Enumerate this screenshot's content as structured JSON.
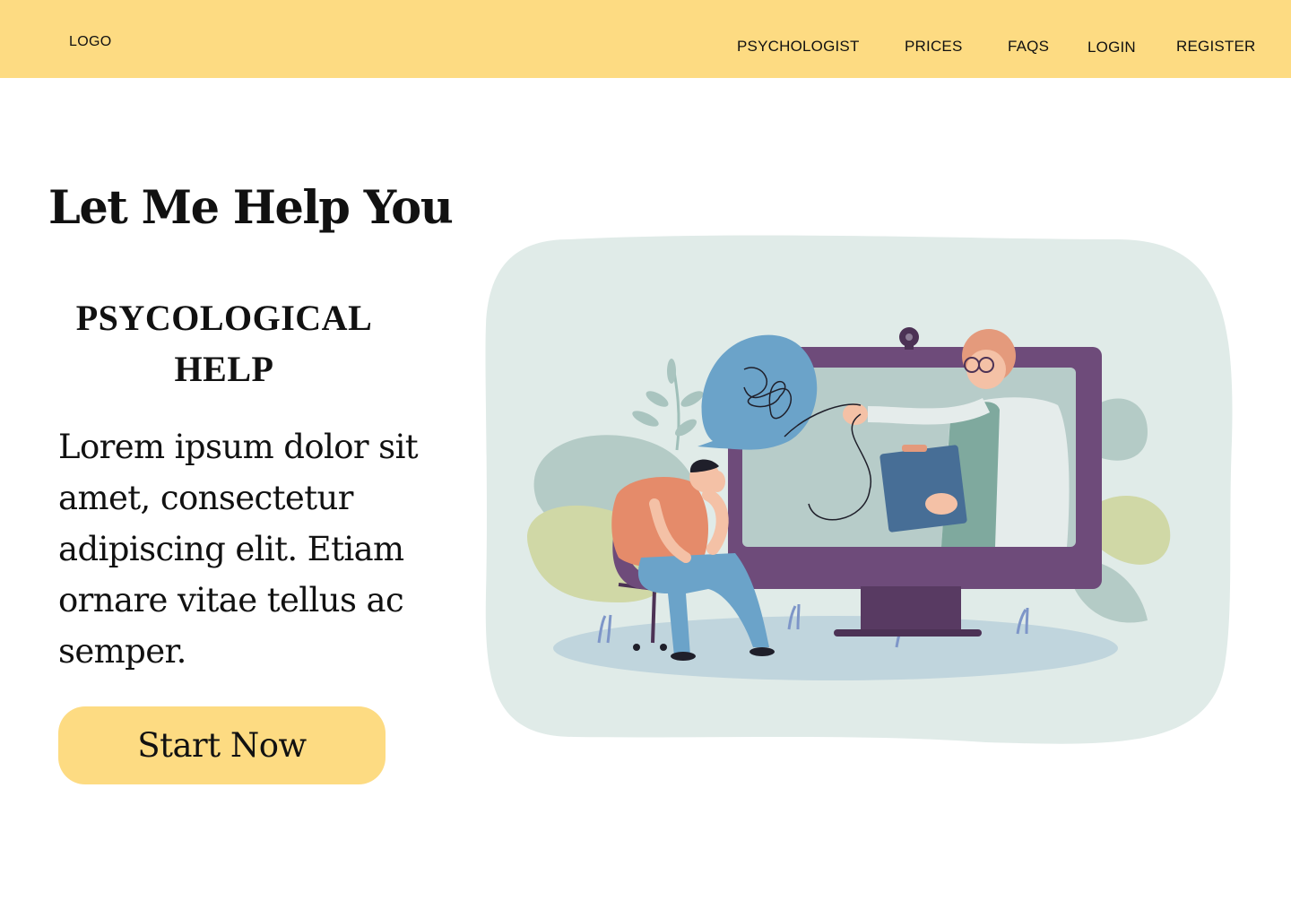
{
  "header": {
    "logo": "LOGO",
    "nav": [
      {
        "label": "PSYCHOLOGIST"
      },
      {
        "label": "PRICES"
      },
      {
        "label": "FAQS"
      },
      {
        "label": "LOGIN"
      },
      {
        "label": "REGISTER"
      }
    ]
  },
  "hero": {
    "title": "Let Me Help You",
    "subtitle_line1": "PSYCOLOGICAL",
    "subtitle_line2": "HELP",
    "paragraph": "Lorem ipsum dolor sit amet, consectetur adipiscing elit. Etiam ornare vitae tellus ac semper.",
    "cta_label": "Start Now"
  },
  "illustration": {
    "subject": "online-therapy-session-illustration"
  },
  "colors": {
    "accent": "#FDDB82",
    "backdrop": "#E0EBE8",
    "monitor": "#6E4B7A",
    "bubble": "#6BA3C9"
  }
}
